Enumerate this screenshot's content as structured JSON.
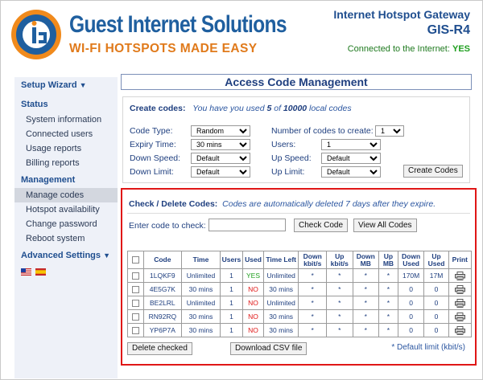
{
  "header": {
    "brand": "Guest Internet Solutions",
    "tagline": "WI-FI HOTSPOTS MADE EASY",
    "product": "Internet Hotspot Gateway",
    "model": "GIS-R4",
    "connection_label": "Connected to the Internet:",
    "connection_status": "YES"
  },
  "sidebar": {
    "setup_wizard": "Setup Wizard",
    "status_head": "Status",
    "status_items": [
      "System information",
      "Connected users",
      "Usage reports",
      "Billing reports"
    ],
    "management_head": "Management",
    "management_items": [
      "Manage codes",
      "Hotspot availability",
      "Change password",
      "Reboot system"
    ],
    "advanced": "Advanced Settings"
  },
  "main": {
    "title": "Access Code Management",
    "create": {
      "label": "Create codes:",
      "usage_prefix": "You have you used",
      "used": "5",
      "usage_mid": "of",
      "limit": "10000",
      "usage_suffix": "local codes",
      "fields": {
        "code_type_label": "Code Type:",
        "code_type_value": "Random",
        "expiry_label": "Expiry Time:",
        "expiry_value": "30 mins",
        "down_speed_label": "Down Speed:",
        "down_speed_value": "Default",
        "down_limit_label": "Down Limit:",
        "down_limit_value": "Default",
        "num_codes_label": "Number of codes to create:",
        "num_codes_value": "1",
        "users_label": "Users:",
        "users_value": "1",
        "up_speed_label": "Up Speed:",
        "up_speed_value": "Default",
        "up_limit_label": "Up Limit:",
        "up_limit_value": "Default"
      },
      "button": "Create Codes"
    },
    "check": {
      "label": "Check / Delete Codes:",
      "note": "Codes are automatically deleted 7 days after they expire.",
      "input_label": "Enter code to check:",
      "input_value": "",
      "check_button": "Check Code",
      "view_button": "View All Codes",
      "columns": [
        "",
        "Code",
        "Time",
        "Users",
        "Used",
        "Time Left",
        "Down kbit/s",
        "Up kbit/s",
        "Down MB",
        "Up MB",
        "Down Used",
        "Up Used",
        "Print"
      ],
      "rows": [
        {
          "code": "1LQKF9",
          "time": "Unlimited",
          "users": "1",
          "used": "YES",
          "left": "Unlimited",
          "dk": "*",
          "uk": "*",
          "dmb": "*",
          "umb": "*",
          "du": "170M",
          "uu": "17M"
        },
        {
          "code": "4E5G7K",
          "time": "30 mins",
          "users": "1",
          "used": "NO",
          "left": "30 mins",
          "dk": "*",
          "uk": "*",
          "dmb": "*",
          "umb": "*",
          "du": "0",
          "uu": "0"
        },
        {
          "code": "BE2LRL",
          "time": "Unlimited",
          "users": "1",
          "used": "NO",
          "left": "Unlimited",
          "dk": "*",
          "uk": "*",
          "dmb": "*",
          "umb": "*",
          "du": "0",
          "uu": "0"
        },
        {
          "code": "RN92RQ",
          "time": "30 mins",
          "users": "1",
          "used": "NO",
          "left": "30 mins",
          "dk": "*",
          "uk": "*",
          "dmb": "*",
          "umb": "*",
          "du": "0",
          "uu": "0"
        },
        {
          "code": "YP6P7A",
          "time": "30 mins",
          "users": "1",
          "used": "NO",
          "left": "30 mins",
          "dk": "*",
          "uk": "*",
          "dmb": "*",
          "umb": "*",
          "du": "0",
          "uu": "0"
        }
      ],
      "delete_button": "Delete checked",
      "csv_button": "Download CSV file",
      "footnote": "* Default limit (kbit/s)"
    }
  },
  "colors": {
    "brand_blue": "#1f5f9f",
    "brand_orange": "#e07a1b",
    "highlight_red": "#e01616",
    "yes_green": "#1f9f1f"
  }
}
